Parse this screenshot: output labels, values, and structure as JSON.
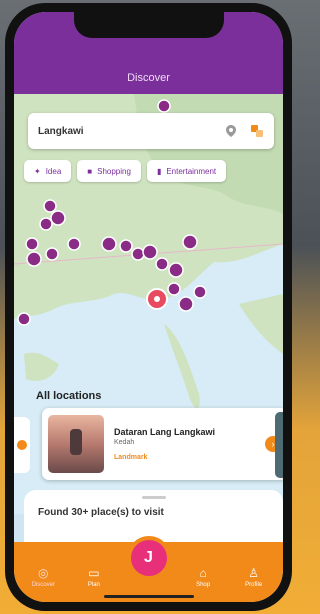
{
  "header": {
    "title": "Discover"
  },
  "search": {
    "value": "Langkawi",
    "icons": [
      "location-pin-icon",
      "filter-icon"
    ]
  },
  "chips": [
    {
      "label": "Idea",
      "icon": "sparkle-icon"
    },
    {
      "label": "Shopping",
      "icon": "bag-icon"
    },
    {
      "label": "Entertainment",
      "icon": "ticket-icon"
    }
  ],
  "section": {
    "title": "All locations"
  },
  "location_card": {
    "name": "Dataran Lang Langkawi",
    "region": "Kedah",
    "type": "Landmark"
  },
  "sheet": {
    "text": "Found 30+ place(s) to visit"
  },
  "tabs": [
    {
      "label": "Discover",
      "icon": "compass-icon",
      "active": true
    },
    {
      "label": "Plan",
      "icon": "calendar-icon",
      "active": false
    },
    {
      "label": "Shop",
      "icon": "shop-icon",
      "active": false
    },
    {
      "label": "Profile",
      "icon": "person-icon",
      "active": false
    }
  ],
  "colors": {
    "brand_purple": "#7b2f9b",
    "accent_orange": "#f28a1a",
    "fab_pink": "#e8307a",
    "marker": "#8a2c86"
  }
}
